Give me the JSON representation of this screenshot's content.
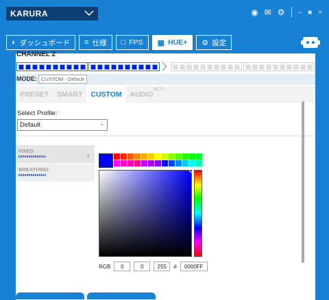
{
  "header": {
    "device": "KARURA"
  },
  "nav": {
    "tabs": [
      {
        "label": "ダッシュボード",
        "icon": "gauge-icon"
      },
      {
        "label": "仕様",
        "icon": "list-icon"
      },
      {
        "label": "FPS",
        "icon": "square-icon"
      },
      {
        "label": "HUE+",
        "icon": "grid-icon"
      },
      {
        "label": "設定",
        "icon": "gear-icon"
      }
    ],
    "active": "HUE+"
  },
  "channel": {
    "title": "CHANNEL 2",
    "strips": [
      {
        "count": 10,
        "on": true
      },
      {
        "count": 10,
        "on": true
      },
      {
        "count": 10,
        "on": false
      },
      {
        "count": 10,
        "on": false
      }
    ]
  },
  "mode": {
    "label": "MODE:",
    "value": "CUSTOM - Default"
  },
  "subtabs": {
    "items": [
      "PRESET",
      "SMART",
      "CUSTOM",
      "AUDIO"
    ],
    "active": "CUSTOM",
    "beta": "BETA"
  },
  "profile": {
    "label": "Select Profile:",
    "value": "Default"
  },
  "effects": [
    {
      "name": "FIXED"
    },
    {
      "name": "BREATHING"
    }
  ],
  "color": {
    "selected": "#0000ff",
    "swatches_top": [
      "#ff0000",
      "#ff2200",
      "#ff5500",
      "#ff8800",
      "#ffaa00",
      "#ffcc00",
      "#ffff00",
      "#ccff00",
      "#88ff00",
      "#55ff00",
      "#22ff00",
      "#00ff00",
      "#00ff22"
    ],
    "swatches_bottom": [
      "#ff00ff",
      "#ff00cc",
      "#ff00aa",
      "#ff0088",
      "#cc00ff",
      "#aa00ff",
      "#8800ff",
      "#0000ff",
      "#0044ff",
      "#0088ff",
      "#00ccff",
      "#00ffff",
      "#00ffaa"
    ],
    "rgb_label": "RGB",
    "r": "0",
    "g": "0",
    "b": "255",
    "hash": "#",
    "hex": "0000FF"
  }
}
